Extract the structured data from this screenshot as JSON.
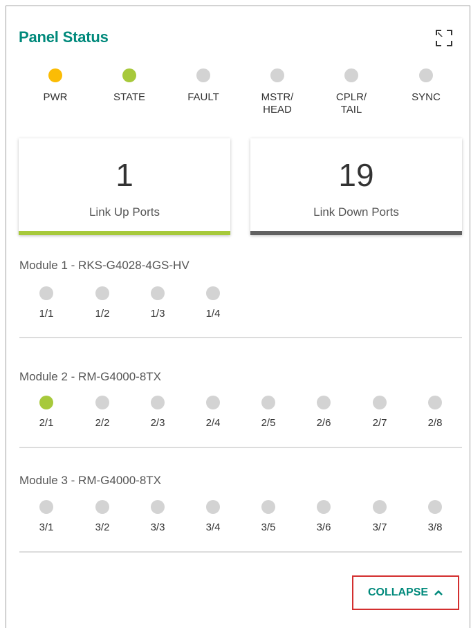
{
  "panel": {
    "title": "Panel Status",
    "fullscreen_icon": "fullscreen-icon"
  },
  "status_leds": [
    {
      "label": "PWR",
      "color": "#fbbc05"
    },
    {
      "label": "STATE",
      "color": "#a7c93b"
    },
    {
      "label": "FAULT",
      "color": "#d3d3d3"
    },
    {
      "label": "MSTR/\nHEAD",
      "color": "#d3d3d3"
    },
    {
      "label": "CPLR/\nTAIL",
      "color": "#d3d3d3"
    },
    {
      "label": "SYNC",
      "color": "#d3d3d3"
    }
  ],
  "cards": {
    "link_up": {
      "value": "1",
      "label": "Link Up Ports",
      "bar_color": "#a7c93b"
    },
    "link_down": {
      "value": "19",
      "label": "Link Down Ports",
      "bar_color": "#616161"
    }
  },
  "modules": [
    {
      "title": "Module 1 - RKS-G4028-4GS-HV",
      "ports": [
        {
          "label": "1/1",
          "color": "#d3d3d3"
        },
        {
          "label": "1/2",
          "color": "#d3d3d3"
        },
        {
          "label": "1/3",
          "color": "#d3d3d3"
        },
        {
          "label": "1/4",
          "color": "#d3d3d3"
        }
      ]
    },
    {
      "title": "Module 2 - RM-G4000-8TX",
      "ports": [
        {
          "label": "2/1",
          "color": "#a7c93b"
        },
        {
          "label": "2/2",
          "color": "#d3d3d3"
        },
        {
          "label": "2/3",
          "color": "#d3d3d3"
        },
        {
          "label": "2/4",
          "color": "#d3d3d3"
        },
        {
          "label": "2/5",
          "color": "#d3d3d3"
        },
        {
          "label": "2/6",
          "color": "#d3d3d3"
        },
        {
          "label": "2/7",
          "color": "#d3d3d3"
        },
        {
          "label": "2/8",
          "color": "#d3d3d3"
        }
      ]
    },
    {
      "title": "Module 3 - RM-G4000-8TX",
      "ports": [
        {
          "label": "3/1",
          "color": "#d3d3d3"
        },
        {
          "label": "3/2",
          "color": "#d3d3d3"
        },
        {
          "label": "3/3",
          "color": "#d3d3d3"
        },
        {
          "label": "3/4",
          "color": "#d3d3d3"
        },
        {
          "label": "3/5",
          "color": "#d3d3d3"
        },
        {
          "label": "3/6",
          "color": "#d3d3d3"
        },
        {
          "label": "3/7",
          "color": "#d3d3d3"
        },
        {
          "label": "3/8",
          "color": "#d3d3d3"
        }
      ]
    }
  ],
  "collapse": {
    "label": "COLLAPSE",
    "icon": "chevron-up-icon",
    "color": "#00897b"
  },
  "colors": {
    "accent": "#00897b",
    "led_off": "#d3d3d3",
    "led_on_green": "#a7c93b",
    "led_on_amber": "#fbbc05",
    "highlight_border": "#d32f2f"
  }
}
